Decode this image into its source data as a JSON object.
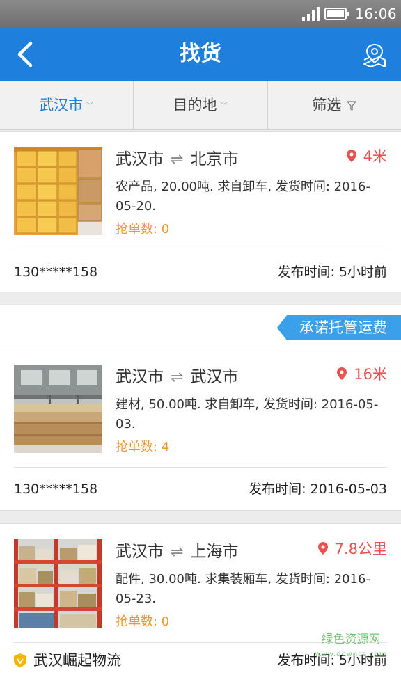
{
  "status_bar": {
    "time": "16:06",
    "icons": [
      "signal-icon",
      "battery-icon"
    ]
  },
  "header": {
    "title": "找货",
    "back_icon": "chevron-left-icon",
    "map_icon": "map-location-icon"
  },
  "filters": [
    {
      "label": "武汉市",
      "active": true,
      "icon": "chevron-down-icon"
    },
    {
      "label": "目的地",
      "active": false,
      "icon": "chevron-down-icon"
    },
    {
      "label": "筛选",
      "active": false,
      "icon": "funnel-icon"
    }
  ],
  "listings": [
    {
      "from": "武汉市",
      "to": "北京市",
      "distance": "4米",
      "description": "农产品, 20.00吨. 求自卸车, 发货时间: 2016-05-20.",
      "grab_count": "抢单数: 0",
      "contact": "130*****158",
      "published": "发布时间: 5小时前",
      "thumb": "boxes-photo"
    },
    {
      "banner": "承诺托管运费",
      "from": "武汉市",
      "to": "武汉市",
      "distance": "16米",
      "description": "建材, 50.00吨. 求自卸车, 发货时间: 2016-05-03.",
      "grab_count": "抢单数: 4",
      "contact": "130*****158",
      "published": "发布时间: 2016-05-03",
      "thumb": "warehouse-boards-photo"
    },
    {
      "from": "武汉市",
      "to": "上海市",
      "distance": "7.8公里",
      "description": "配件, 30.00吨. 求集装厢车, 发货时间: 2016-05-23.",
      "grab_count": "抢单数: 0",
      "company": "武汉崛起物流",
      "published": "发布时间: 5小时前",
      "thumb": "shelves-photo"
    }
  ],
  "watermark": {
    "text": "绿色资源网",
    "sub": "www.downcc.com"
  },
  "colors": {
    "primary": "#1e7fdd",
    "distance": "#e8524f",
    "grab": "#f0962a",
    "banner": "#3aa0ea"
  }
}
